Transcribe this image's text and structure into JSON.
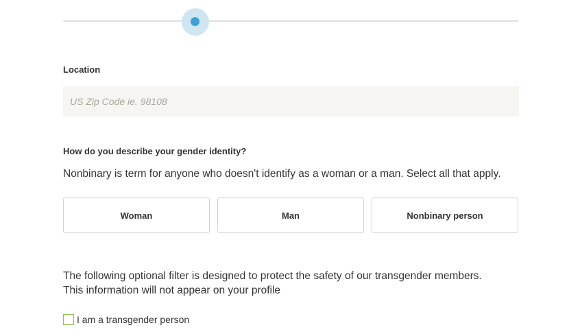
{
  "slider": {
    "value_fraction": 0.29
  },
  "location": {
    "label": "Location",
    "input_value": "",
    "placeholder": "US Zip Code ie. 98108"
  },
  "gender": {
    "question": "How do you describe your gender identity?",
    "help": "Nonbinary is term for anyone who doesn't identify as a woman or a man. Select all that apply.",
    "options": [
      {
        "label": "Woman"
      },
      {
        "label": "Man"
      },
      {
        "label": "Nonbinary person"
      }
    ]
  },
  "transgender": {
    "notice_line1": "The following optional filter is designed to protect the safety of our transgender members.",
    "notice_line2": "This information will not appear on your profile",
    "checkbox_label": "I am a transgender person",
    "checked": false
  },
  "colors": {
    "slider_thumb": "#3aa3d4",
    "slider_halo": "#cfe6f2",
    "checkbox_border": "#8bc34a",
    "input_bg": "#f6f5f2"
  }
}
